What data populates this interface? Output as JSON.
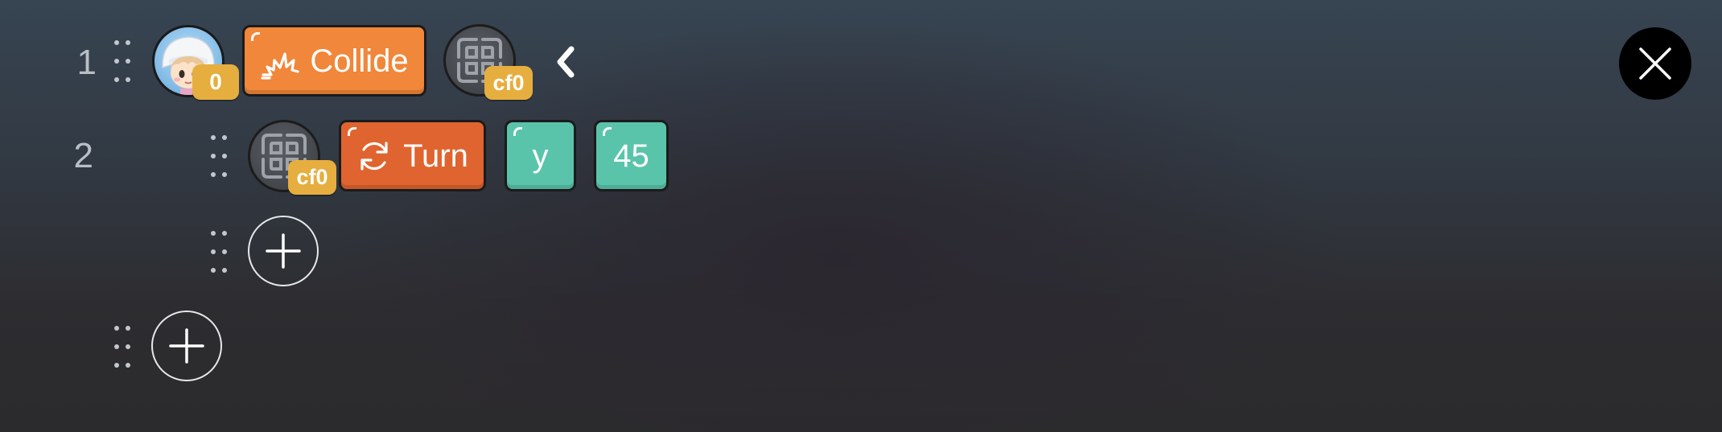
{
  "rows": [
    {
      "line_number": "1",
      "actor_badge": "0",
      "event_block": {
        "label": "Collide",
        "icon": "collision-burst-icon",
        "color": "#f0873a"
      },
      "target_badge": "cf0",
      "collapse_icon": "chevron-left-icon"
    },
    {
      "line_number": "2",
      "target_badge": "cf0",
      "action_block": {
        "label": "Turn",
        "icon": "rotate-icon",
        "color": "#e0642f"
      },
      "params": [
        {
          "value": "y",
          "color": "#5ac4ab"
        },
        {
          "value": "45",
          "color": "#5ac4ab"
        }
      ]
    }
  ],
  "add_buttons": [
    {
      "name": "add-action-button",
      "icon": "plus-icon"
    },
    {
      "name": "add-rule-button",
      "icon": "plus-icon"
    }
  ],
  "close_button": {
    "icon": "close-icon"
  }
}
